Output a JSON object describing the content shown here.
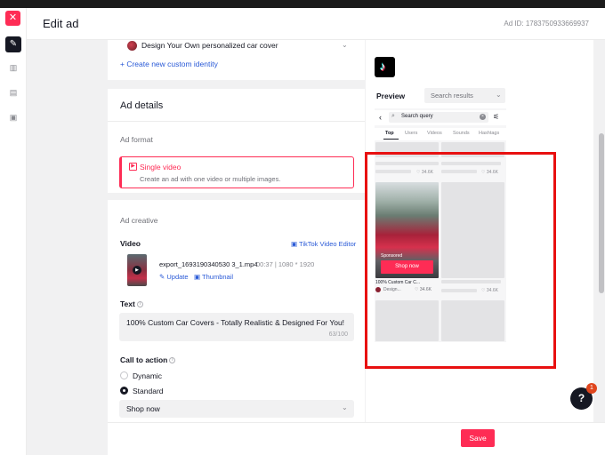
{
  "header": {
    "title": "Edit ad",
    "ad_id": "Ad ID: 1783750933669937"
  },
  "identity": {
    "selected": "Design Your Own personalized car cover",
    "create_link": "+ Create new custom identity"
  },
  "ad_details": {
    "title": "Ad details",
    "format_label": "Ad format",
    "format_option": {
      "title": "Single video",
      "description": "Create an ad with one video or multiple images."
    }
  },
  "ad_creative": {
    "title": "Ad creative",
    "video_label": "Video",
    "tiktok_editor": "TikTok Video Editor",
    "filename": "export_1693190340530 3_1.mp4",
    "meta": "00:37  |  1080 * 1920",
    "update": "Update",
    "thumbnail": "Thumbnail",
    "text_label": "Text",
    "text_value": "100% Custom Car Covers - Totally Realistic & Designed For You!",
    "text_count": "63/100",
    "cta_label": "Call to action",
    "cta_options": [
      "Dynamic",
      "Standard"
    ],
    "cta_selected": "Standard",
    "cta_value": "Shop now"
  },
  "footer": {
    "save": "Save"
  },
  "preview": {
    "label": "Preview",
    "placement": "Search results",
    "search_placeholder": "Search query",
    "tabs": [
      "Top",
      "Users",
      "Videos",
      "Sounds",
      "Hashtags"
    ],
    "active_tab": "Top",
    "stub_likes": [
      "34.6K",
      "34.6K",
      "34.6K"
    ],
    "ad": {
      "sponsored": "Sponsored",
      "cta": "Shop now",
      "caption": "100% Custom Car C...",
      "author": "Design...",
      "likes": "34.6K"
    }
  },
  "help": {
    "icon": "?",
    "badge": "1"
  },
  "colors": {
    "accent": "#fe2c55",
    "link": "#2a5ad7",
    "highlight": "#e81010"
  }
}
